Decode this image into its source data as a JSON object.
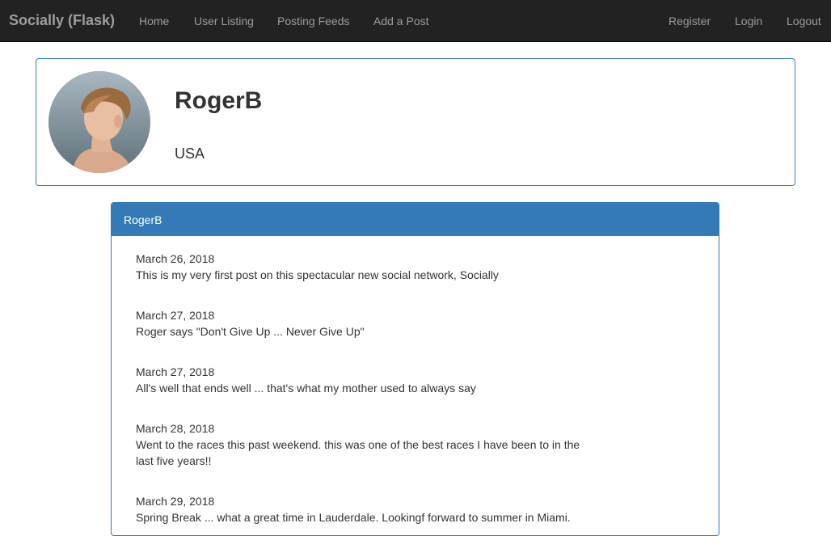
{
  "navbar": {
    "brand": "Socially (Flask)",
    "left_links": [
      "Home",
      "User Listing",
      "Posting Feeds",
      "Add a Post"
    ],
    "right_links": [
      "Register",
      "Login",
      "Logout"
    ]
  },
  "profile": {
    "username": "RogerB",
    "location": "USA",
    "avatar_icon": "user-avatar-photo"
  },
  "feed": {
    "heading": "RogerB",
    "posts": [
      {
        "date": "March 26, 2018",
        "text": "This is my very first post on this spectacular new social network, Socially"
      },
      {
        "date": "March 27, 2018",
        "text": "Roger says \"Don't Give Up ... Never Give Up\""
      },
      {
        "date": "March 27, 2018",
        "text": "All's well that ends well ... that's what my mother used to always say"
      },
      {
        "date": "March 28, 2018",
        "text": "Went to the races this past weekend. this was one of the best races I have been to in the last five years!!"
      },
      {
        "date": "March 29, 2018",
        "text": "Spring Break ... what a great time in Lauderdale. Lookingf forward to summer in Miami."
      }
    ]
  },
  "colors": {
    "navbar_bg": "#222222",
    "nav_text": "#9d9d9d",
    "primary": "#337ab7"
  }
}
